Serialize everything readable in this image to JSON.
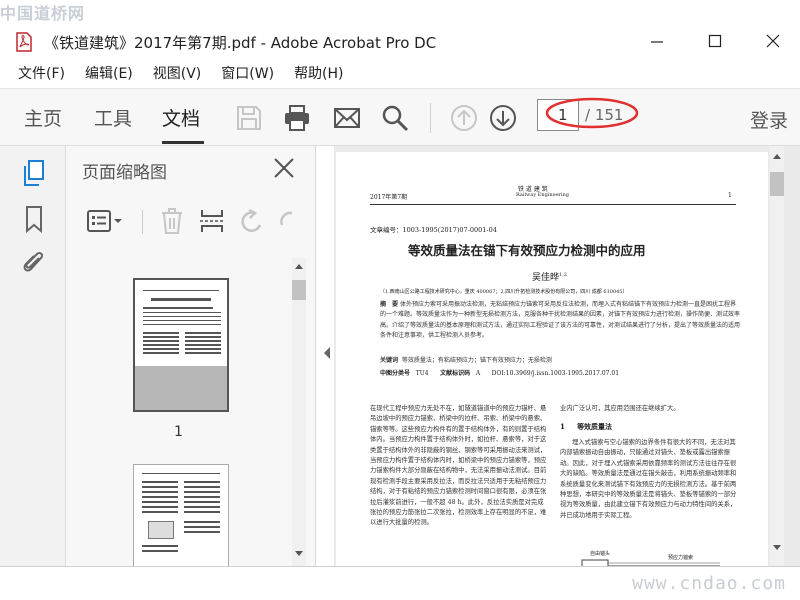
{
  "watermarks": {
    "top": "中国道桥网",
    "bottom": "www.cndao.com"
  },
  "window": {
    "title": "《铁道建筑》2017年第7期.pdf - Adobe Acrobat Pro DC"
  },
  "menu": [
    "文件(F)",
    "编辑(E)",
    "视图(V)",
    "窗口(W)",
    "帮助(H)"
  ],
  "toolbar": {
    "tabs": [
      "主页",
      "工具",
      "文档"
    ],
    "active_tab": "文档",
    "current_page": "1",
    "total_pages": "/ 151",
    "login": "登录"
  },
  "thumbnails": {
    "title": "页面缩略图",
    "first_label": "1"
  },
  "document": {
    "header_left": "2017年第7期",
    "header_center": "铁  道  建  筑",
    "header_center_en": "Railway Engineering",
    "header_page": "1",
    "article_no": "文章编号：1003-1995(2017)07-0001-04",
    "title": "等效质量法在锚下有效预应力检测中的应用",
    "author": "吴佳晔",
    "author_sup": "1,2",
    "affiliation": "（1.西南山区公路工程技术研究中心，重庆 400067；2.四川升拓检测技术股份有限公司，四川 成都 610045）",
    "abstract_label": "摘　要",
    "abstract": "体外预应力索可采用振动法检测，无粘结预应力锚索可采用反拉法检测，而埋入式有粘结锚下有效预应力检测一直是困扰工程界的一个难题。等效质量法作为一种新型无损检测方法，克服各种干扰检测结果的因素，对锚下有效预应力进行检测，操作简便、测试效率高。介绍了等效质量法的基本原理和测试方法，通过实际工程验证了该方法的可靠性，对测试结果进行了分析，提出了等效质量法的适用条件和注意事项，供工程检测人员参考。",
    "keywords_label": "关键词",
    "keywords": "等效质量法；有粘结预应力；锚下有效预应力；无损检测",
    "clc_label": "中图分类号",
    "clc": "TU4",
    "doc_code_label": "文献标识码",
    "doc_code": "A",
    "doi": "DOI:10.3969/j.issn.1003-1995.2017.07.01",
    "body_left": "在现代工程中预应力无处不在，如隧道锚道中的预应力锚杆、悬吊边坡中的预应力锚索、桥梁中的拉杆、吊索、桥梁中的悬索、锚索等等。这些预应力构件有的置于结构体外，有的则置于结构体内。当预应力构件置于结构体外时，如拉杆、悬索等，对于这类置于结构体外的非隐蔽的钢丝、钢索等可采用振动法来测试，当预应力构件置于结构体内时，如桥梁中的预应力锚索等，预应力锚索构件大部分隐蔽在结构物中，无法采用振动法测试。目前现有检测手段主要采用反拉法，而反拉法只适用于无粘结预应力结构，对于有粘结的预应力锚索检测时间窗口很有限，必须在张拉后灌浆前进行，一般不超 48 h。此外，反拉法实质是对完成张拉的预应力筋张拉二次张拉，检测效率上存在明显的不足，难以进行大批量的检测。",
    "body_right_first": "业内广泛认可，其应用范围还在继续扩大。",
    "section_no": "1",
    "section_title": "等效质量法",
    "body_right": "埋入式锚索与空心锚索的边界条件有很大的不同，无法对其内部锚索振动自由振动，只能通过对锚头、垫板或露出锚索振动。因此，对于埋入式锚索采用依靠频率的测试方法往往存在很大的缺陷。等效质量法是通过在锚头敲击，利用系统振动频率和系统质量变化来测试锚下有效预应力的无损检测方法。基于前两种思想，本研究中的等效质量法是将锚头、垫板等锚索的一部分视为等效质量，由此建立锚下有效预应力与动力特性间的关系，并已成功地用于实际工程。",
    "figure_labels": [
      "自由锚头",
      "预应力锚索"
    ]
  }
}
